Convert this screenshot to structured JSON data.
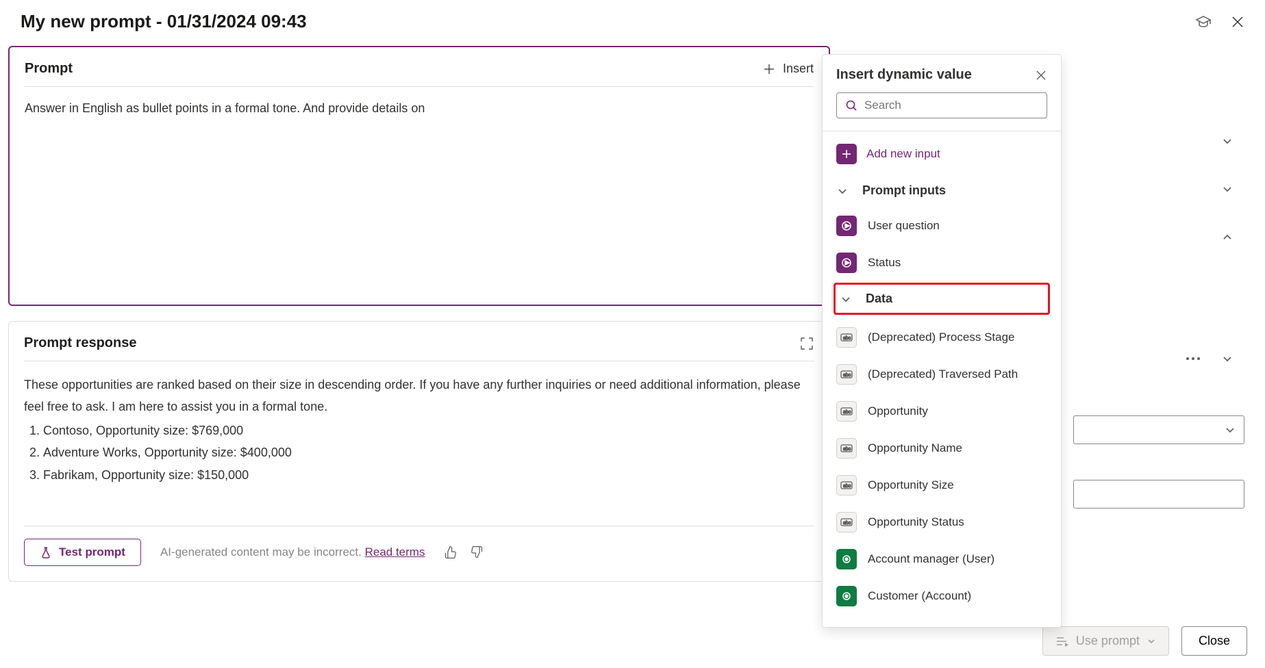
{
  "header": {
    "title": "My new prompt - 01/31/2024 09:43"
  },
  "prompt": {
    "section_title": "Prompt",
    "insert_label": "Insert",
    "text": "Answer in English as bullet points in a formal tone. And provide details on"
  },
  "response": {
    "section_title": "Prompt response",
    "intro": "These opportunities are ranked based on their size in descending order. If you have any further inquiries or need additional information, please feel free to ask. I am here to assist you in a formal tone.",
    "items": [
      "Contoso, Opportunity size: $769,000",
      "Adventure Works, Opportunity size: $400,000",
      "Fabrikam, Opportunity size: $150,000"
    ],
    "test_label": "Test prompt",
    "disclaimer": "AI-generated content may be incorrect.",
    "read_terms": "Read terms"
  },
  "panel": {
    "title": "Insert dynamic value",
    "search_placeholder": "Search",
    "add_input_label": "Add new input",
    "group_prompt_inputs": "Prompt inputs",
    "prompt_inputs": [
      "User question",
      "Status"
    ],
    "group_data": "Data",
    "data_items": [
      {
        "label": "(Deprecated) Process Stage",
        "kind": "field"
      },
      {
        "label": "(Deprecated) Traversed Path",
        "kind": "field"
      },
      {
        "label": "Opportunity",
        "kind": "field"
      },
      {
        "label": "Opportunity Name",
        "kind": "field"
      },
      {
        "label": "Opportunity Size",
        "kind": "field"
      },
      {
        "label": "Opportunity Status",
        "kind": "field"
      },
      {
        "label": "Account manager (User)",
        "kind": "lookup"
      },
      {
        "label": "Customer (Account)",
        "kind": "lookup"
      }
    ]
  },
  "footer": {
    "use_prompt": "Use prompt",
    "close": "Close"
  }
}
